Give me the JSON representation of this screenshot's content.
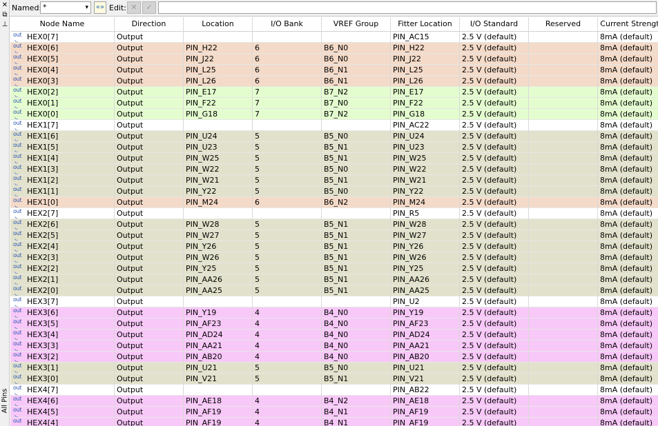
{
  "sidebar": {
    "close_glyph": "✕",
    "dock_glyph": "⧉",
    "pin_glyph": "⊥",
    "label": "All Pins"
  },
  "toolbar": {
    "named_label": "Named:",
    "named_value": "*",
    "dropdown_glyph": "▾",
    "filter_glyph": "«»",
    "edit_label": "Edit:",
    "cancel_glyph": "✕",
    "accept_glyph": "✓",
    "edit_value": ""
  },
  "colors": {
    "bank6": "#f4dac8",
    "bank7": "#e4fdcf",
    "bank5": "#e2e2cc",
    "bank4": "#f8c8f8",
    "none": "#ffffff",
    "icon": "#2a55b5"
  },
  "columns": [
    "Node Name",
    "Direction",
    "Location",
    "I/O Bank",
    "VREF Group",
    "Fitter Location",
    "I/O Standard",
    "Reserved",
    "Current Strength"
  ],
  "rows": [
    {
      "name": "HEX0[7]",
      "dir": "Output",
      "loc": "",
      "bank": "",
      "vref": "",
      "fit": "PIN_AC15",
      "std": "2.5 V (default)",
      "res": "",
      "cur": "8mA (default)"
    },
    {
      "name": "HEX0[6]",
      "dir": "Output",
      "loc": "PIN_H22",
      "bank": "6",
      "vref": "B6_N0",
      "fit": "PIN_H22",
      "std": "2.5 V (default)",
      "res": "",
      "cur": "8mA (default)"
    },
    {
      "name": "HEX0[5]",
      "dir": "Output",
      "loc": "PIN_J22",
      "bank": "6",
      "vref": "B6_N0",
      "fit": "PIN_J22",
      "std": "2.5 V (default)",
      "res": "",
      "cur": "8mA (default)"
    },
    {
      "name": "HEX0[4]",
      "dir": "Output",
      "loc": "PIN_L25",
      "bank": "6",
      "vref": "B6_N1",
      "fit": "PIN_L25",
      "std": "2.5 V (default)",
      "res": "",
      "cur": "8mA (default)"
    },
    {
      "name": "HEX0[3]",
      "dir": "Output",
      "loc": "PIN_L26",
      "bank": "6",
      "vref": "B6_N1",
      "fit": "PIN_L26",
      "std": "2.5 V (default)",
      "res": "",
      "cur": "8mA (default)"
    },
    {
      "name": "HEX0[2]",
      "dir": "Output",
      "loc": "PIN_E17",
      "bank": "7",
      "vref": "B7_N2",
      "fit": "PIN_E17",
      "std": "2.5 V (default)",
      "res": "",
      "cur": "8mA (default)"
    },
    {
      "name": "HEX0[1]",
      "dir": "Output",
      "loc": "PIN_F22",
      "bank": "7",
      "vref": "B7_N0",
      "fit": "PIN_F22",
      "std": "2.5 V (default)",
      "res": "",
      "cur": "8mA (default)"
    },
    {
      "name": "HEX0[0]",
      "dir": "Output",
      "loc": "PIN_G18",
      "bank": "7",
      "vref": "B7_N2",
      "fit": "PIN_G18",
      "std": "2.5 V (default)",
      "res": "",
      "cur": "8mA (default)"
    },
    {
      "name": "HEX1[7]",
      "dir": "Output",
      "loc": "",
      "bank": "",
      "vref": "",
      "fit": "PIN_AC22",
      "std": "2.5 V (default)",
      "res": "",
      "cur": "8mA (default)"
    },
    {
      "name": "HEX1[6]",
      "dir": "Output",
      "loc": "PIN_U24",
      "bank": "5",
      "vref": "B5_N0",
      "fit": "PIN_U24",
      "std": "2.5 V (default)",
      "res": "",
      "cur": "8mA (default)"
    },
    {
      "name": "HEX1[5]",
      "dir": "Output",
      "loc": "PIN_U23",
      "bank": "5",
      "vref": "B5_N1",
      "fit": "PIN_U23",
      "std": "2.5 V (default)",
      "res": "",
      "cur": "8mA (default)"
    },
    {
      "name": "HEX1[4]",
      "dir": "Output",
      "loc": "PIN_W25",
      "bank": "5",
      "vref": "B5_N1",
      "fit": "PIN_W25",
      "std": "2.5 V (default)",
      "res": "",
      "cur": "8mA (default)"
    },
    {
      "name": "HEX1[3]",
      "dir": "Output",
      "loc": "PIN_W22",
      "bank": "5",
      "vref": "B5_N0",
      "fit": "PIN_W22",
      "std": "2.5 V (default)",
      "res": "",
      "cur": "8mA (default)"
    },
    {
      "name": "HEX1[2]",
      "dir": "Output",
      "loc": "PIN_W21",
      "bank": "5",
      "vref": "B5_N1",
      "fit": "PIN_W21",
      "std": "2.5 V (default)",
      "res": "",
      "cur": "8mA (default)"
    },
    {
      "name": "HEX1[1]",
      "dir": "Output",
      "loc": "PIN_Y22",
      "bank": "5",
      "vref": "B5_N0",
      "fit": "PIN_Y22",
      "std": "2.5 V (default)",
      "res": "",
      "cur": "8mA (default)"
    },
    {
      "name": "HEX1[0]",
      "dir": "Output",
      "loc": "PIN_M24",
      "bank": "6",
      "vref": "B6_N2",
      "fit": "PIN_M24",
      "std": "2.5 V (default)",
      "res": "",
      "cur": "8mA (default)"
    },
    {
      "name": "HEX2[7]",
      "dir": "Output",
      "loc": "",
      "bank": "",
      "vref": "",
      "fit": "PIN_R5",
      "std": "2.5 V (default)",
      "res": "",
      "cur": "8mA (default)"
    },
    {
      "name": "HEX2[6]",
      "dir": "Output",
      "loc": "PIN_W28",
      "bank": "5",
      "vref": "B5_N1",
      "fit": "PIN_W28",
      "std": "2.5 V (default)",
      "res": "",
      "cur": "8mA (default)"
    },
    {
      "name": "HEX2[5]",
      "dir": "Output",
      "loc": "PIN_W27",
      "bank": "5",
      "vref": "B5_N1",
      "fit": "PIN_W27",
      "std": "2.5 V (default)",
      "res": "",
      "cur": "8mA (default)"
    },
    {
      "name": "HEX2[4]",
      "dir": "Output",
      "loc": "PIN_Y26",
      "bank": "5",
      "vref": "B5_N1",
      "fit": "PIN_Y26",
      "std": "2.5 V (default)",
      "res": "",
      "cur": "8mA (default)"
    },
    {
      "name": "HEX2[3]",
      "dir": "Output",
      "loc": "PIN_W26",
      "bank": "5",
      "vref": "B5_N1",
      "fit": "PIN_W26",
      "std": "2.5 V (default)",
      "res": "",
      "cur": "8mA (default)"
    },
    {
      "name": "HEX2[2]",
      "dir": "Output",
      "loc": "PIN_Y25",
      "bank": "5",
      "vref": "B5_N1",
      "fit": "PIN_Y25",
      "std": "2.5 V (default)",
      "res": "",
      "cur": "8mA (default)"
    },
    {
      "name": "HEX2[1]",
      "dir": "Output",
      "loc": "PIN_AA26",
      "bank": "5",
      "vref": "B5_N1",
      "fit": "PIN_AA26",
      "std": "2.5 V (default)",
      "res": "",
      "cur": "8mA (default)"
    },
    {
      "name": "HEX2[0]",
      "dir": "Output",
      "loc": "PIN_AA25",
      "bank": "5",
      "vref": "B5_N1",
      "fit": "PIN_AA25",
      "std": "2.5 V (default)",
      "res": "",
      "cur": "8mA (default)"
    },
    {
      "name": "HEX3[7]",
      "dir": "Output",
      "loc": "",
      "bank": "",
      "vref": "",
      "fit": "PIN_U2",
      "std": "2.5 V (default)",
      "res": "",
      "cur": "8mA (default)"
    },
    {
      "name": "HEX3[6]",
      "dir": "Output",
      "loc": "PIN_Y19",
      "bank": "4",
      "vref": "B4_N0",
      "fit": "PIN_Y19",
      "std": "2.5 V (default)",
      "res": "",
      "cur": "8mA (default)"
    },
    {
      "name": "HEX3[5]",
      "dir": "Output",
      "loc": "PIN_AF23",
      "bank": "4",
      "vref": "B4_N0",
      "fit": "PIN_AF23",
      "std": "2.5 V (default)",
      "res": "",
      "cur": "8mA (default)"
    },
    {
      "name": "HEX3[4]",
      "dir": "Output",
      "loc": "PIN_AD24",
      "bank": "4",
      "vref": "B4_N0",
      "fit": "PIN_AD24",
      "std": "2.5 V (default)",
      "res": "",
      "cur": "8mA (default)"
    },
    {
      "name": "HEX3[3]",
      "dir": "Output",
      "loc": "PIN_AA21",
      "bank": "4",
      "vref": "B4_N0",
      "fit": "PIN_AA21",
      "std": "2.5 V (default)",
      "res": "",
      "cur": "8mA (default)"
    },
    {
      "name": "HEX3[2]",
      "dir": "Output",
      "loc": "PIN_AB20",
      "bank": "4",
      "vref": "B4_N0",
      "fit": "PIN_AB20",
      "std": "2.5 V (default)",
      "res": "",
      "cur": "8mA (default)"
    },
    {
      "name": "HEX3[1]",
      "dir": "Output",
      "loc": "PIN_U21",
      "bank": "5",
      "vref": "B5_N0",
      "fit": "PIN_U21",
      "std": "2.5 V (default)",
      "res": "",
      "cur": "8mA (default)"
    },
    {
      "name": "HEX3[0]",
      "dir": "Output",
      "loc": "PIN_V21",
      "bank": "5",
      "vref": "B5_N1",
      "fit": "PIN_V21",
      "std": "2.5 V (default)",
      "res": "",
      "cur": "8mA (default)"
    },
    {
      "name": "HEX4[7]",
      "dir": "Output",
      "loc": "",
      "bank": "",
      "vref": "",
      "fit": "PIN_AB22",
      "std": "2.5 V (default)",
      "res": "",
      "cur": "8mA (default)"
    },
    {
      "name": "HEX4[6]",
      "dir": "Output",
      "loc": "PIN_AE18",
      "bank": "4",
      "vref": "B4_N2",
      "fit": "PIN_AE18",
      "std": "2.5 V (default)",
      "res": "",
      "cur": "8mA (default)"
    },
    {
      "name": "HEX4[5]",
      "dir": "Output",
      "loc": "PIN_AF19",
      "bank": "4",
      "vref": "B4_N1",
      "fit": "PIN_AF19",
      "std": "2.5 V (default)",
      "res": "",
      "cur": "8mA (default)"
    },
    {
      "name": "HEX4[4]",
      "dir": "Output",
      "loc": "PIN_AF19",
      "bank": "4",
      "vref": "B4_N1",
      "fit": "PIN_AF19",
      "std": "2.5 V (default)",
      "res": "",
      "cur": "8mA (default)"
    }
  ],
  "icon": {
    "top": "out",
    "bottom": "↘"
  }
}
